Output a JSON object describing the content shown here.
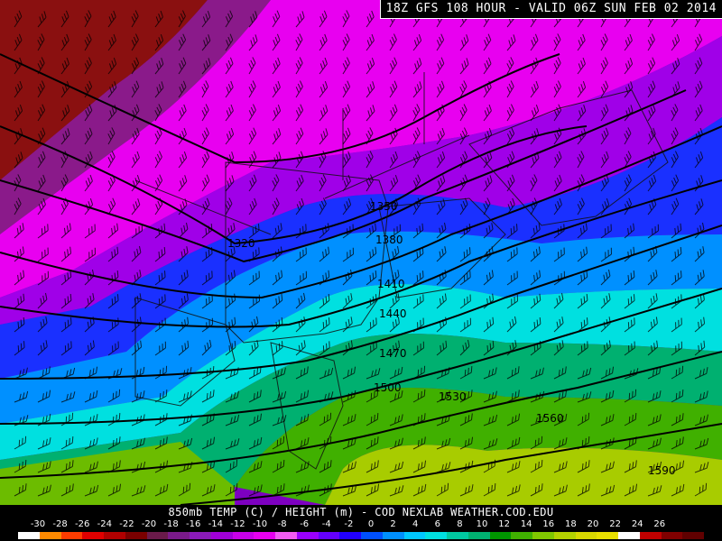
{
  "title": "18Z GFS 108 HOUR - VALID 06Z SUN FEB 02 2014",
  "footer_caption": "850mb TEMP (C) / HEIGHT (m) - COD NEXLAB   WEATHER.COD.EDU",
  "contour_labels": [
    "1350",
    "1320",
    "1380",
    "1410",
    "1440",
    "1470",
    "1500",
    "1530",
    "1560",
    "1590"
  ],
  "colorbar": {
    "labels": [
      "-30",
      "-28",
      "-26",
      "-24",
      "-22",
      "-20",
      "-18",
      "-16",
      "-14",
      "-12",
      "-10",
      "-8",
      "-6",
      "-4",
      "-2",
      "0",
      "2",
      "4",
      "6",
      "8",
      "10",
      "12",
      "14",
      "16",
      "18",
      "20",
      "22",
      "24",
      "26"
    ],
    "colors": [
      "#ffffff",
      "#ff8a00",
      "#ff3c00",
      "#e00000",
      "#b00000",
      "#7a0000",
      "#6a1a4a",
      "#7a1a8a",
      "#8a1ab8",
      "#a000d8",
      "#c800e8",
      "#e800f0",
      "#f25cf2",
      "#9a00ff",
      "#6400ff",
      "#2200ff",
      "#0050ff",
      "#0090ff",
      "#00c8ff",
      "#00e0e0",
      "#00c8a0",
      "#00b070",
      "#009600",
      "#40b000",
      "#80c800",
      "#b4d200",
      "#d8d800",
      "#e8e000",
      "#ffffff",
      "#c00000",
      "#800000",
      "#600000"
    ]
  }
}
